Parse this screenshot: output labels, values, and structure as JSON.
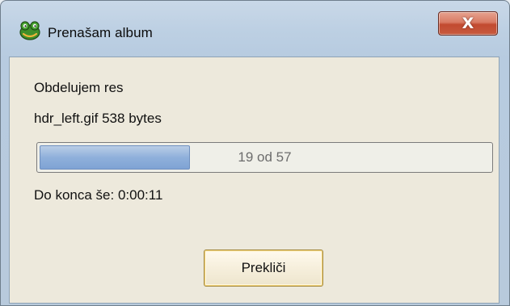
{
  "window": {
    "title": "Prenašam album",
    "app_icon": "frog-icon",
    "close_icon": "close-icon",
    "close_symbol": "X"
  },
  "dialog": {
    "status_label": "Obdelujem res",
    "current_file": "hdr_left.gif 538 bytes",
    "progress": {
      "current": 19,
      "total": 57,
      "text": "19 od 57"
    },
    "time_remaining": "Do konca še: 0:00:11",
    "cancel_label": "Prekliči"
  }
}
